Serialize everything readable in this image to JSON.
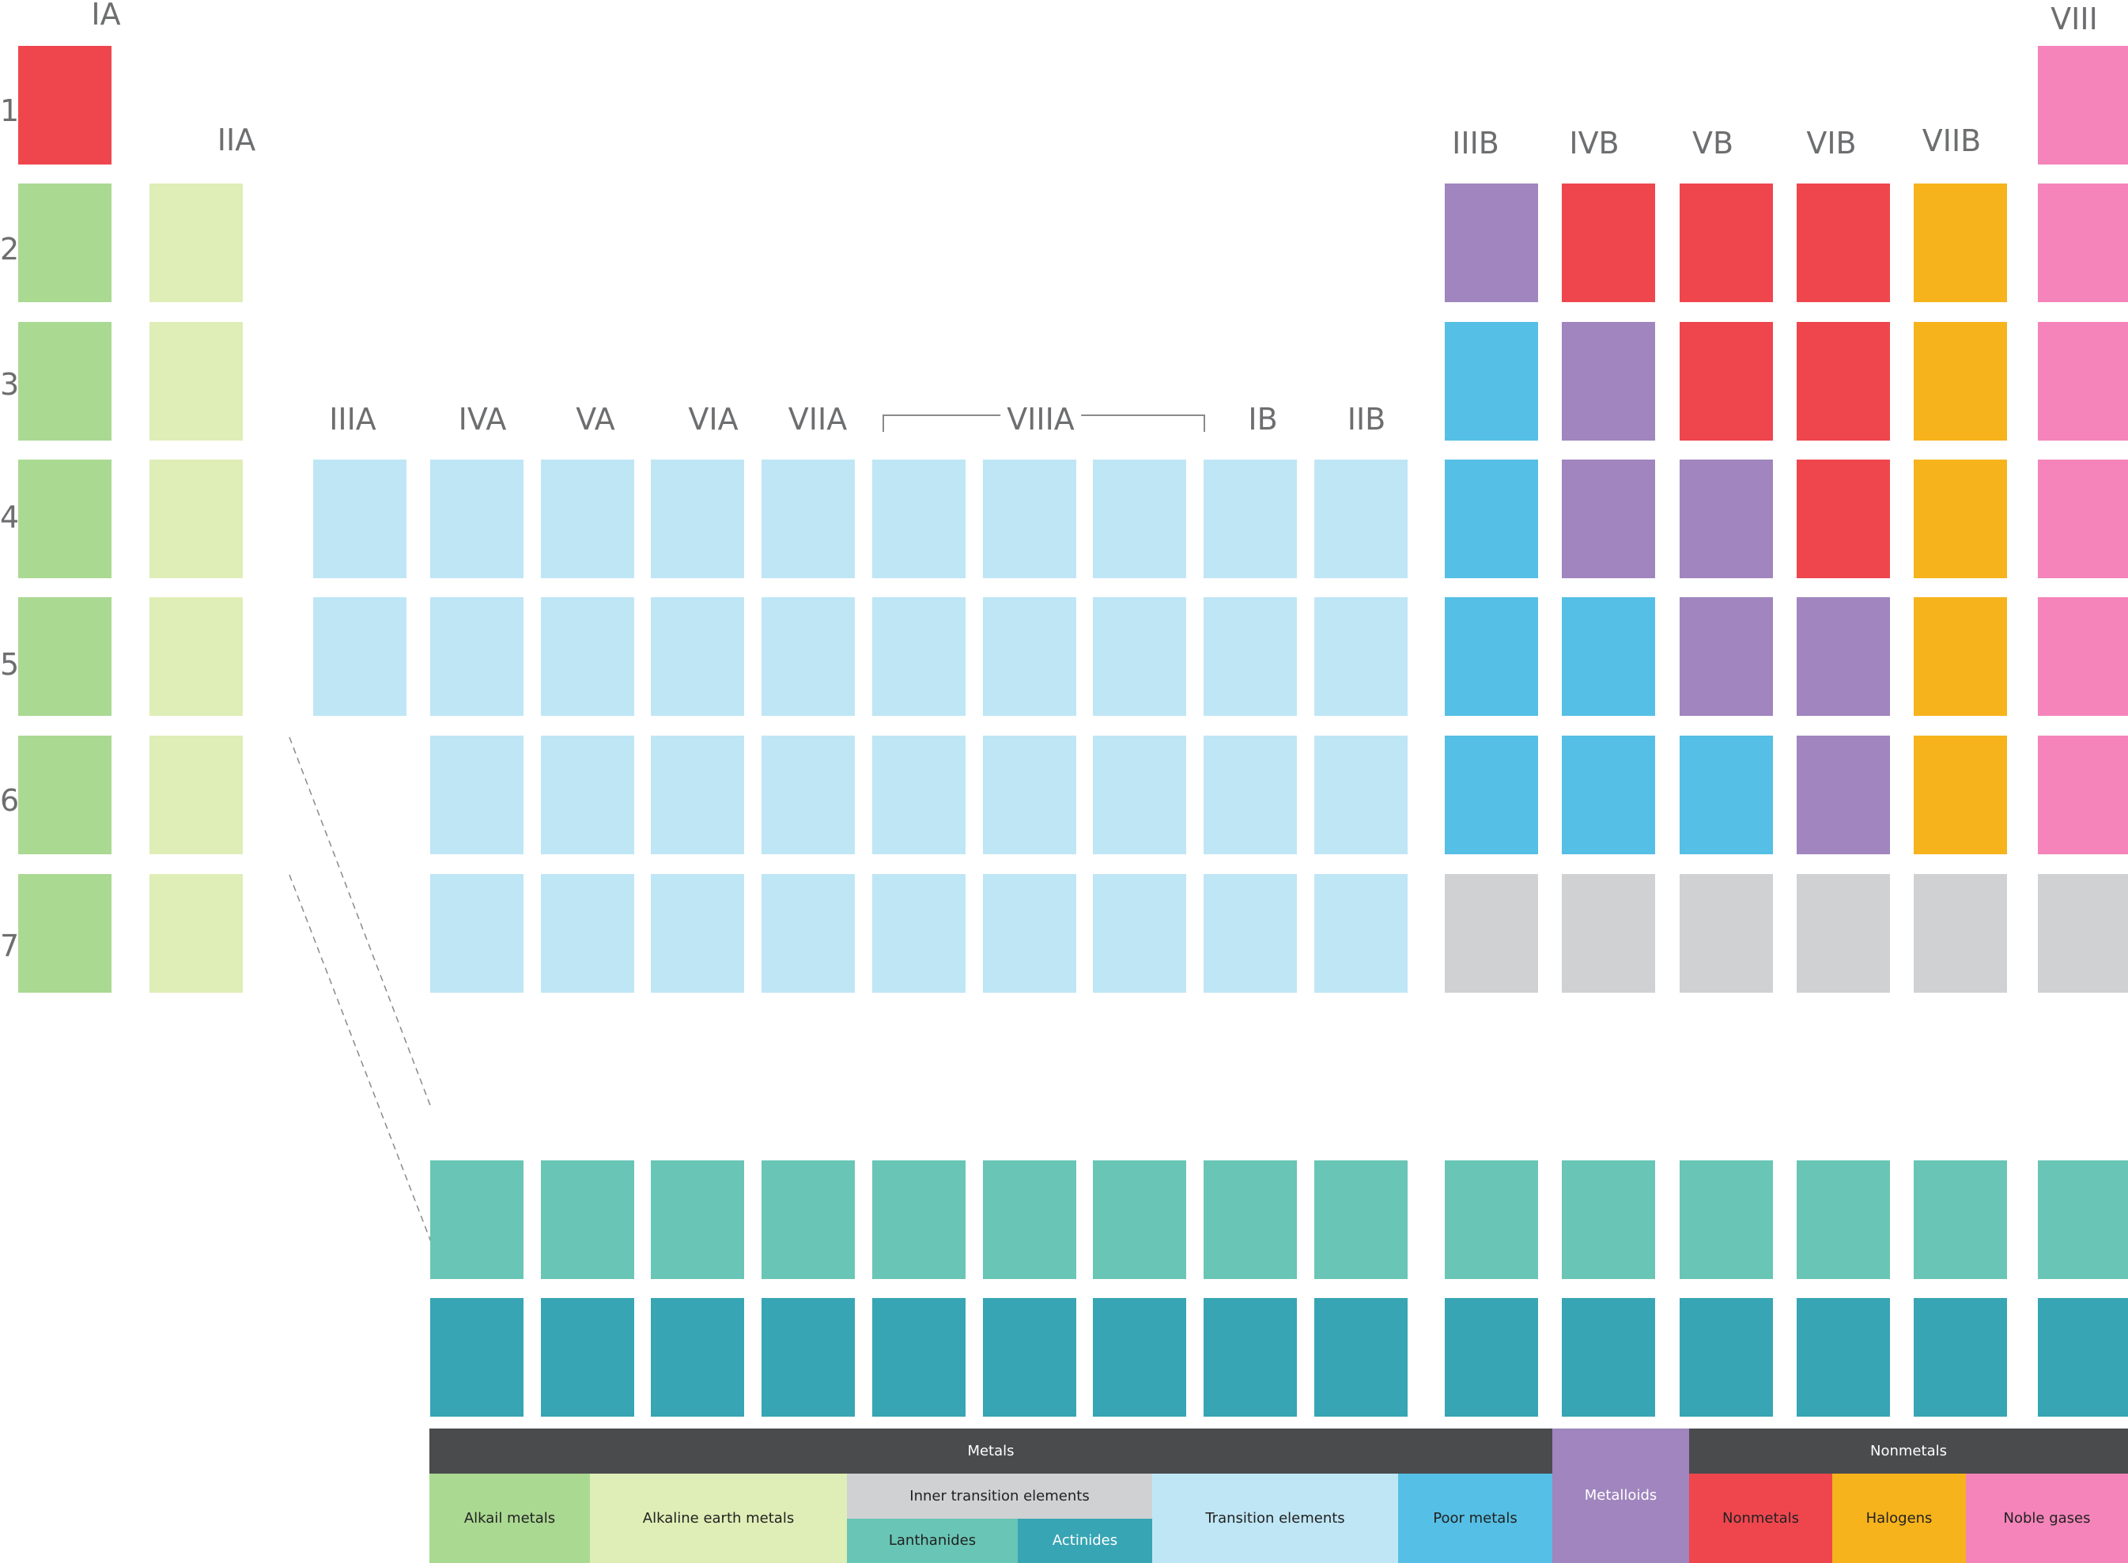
{
  "group_labels": [
    {
      "key": "IA",
      "text": "IA"
    },
    {
      "key": "IIA",
      "text": "IIA"
    },
    {
      "key": "IIIA",
      "text": "IIIA"
    },
    {
      "key": "IVA",
      "text": "IVA"
    },
    {
      "key": "VA",
      "text": "VA"
    },
    {
      "key": "VIA",
      "text": "VIA"
    },
    {
      "key": "VIIA",
      "text": "VIIA"
    },
    {
      "key": "VIIIA",
      "text": "VIIIA"
    },
    {
      "key": "IB",
      "text": "IB"
    },
    {
      "key": "IIB",
      "text": "IIB"
    },
    {
      "key": "IIIB",
      "text": "IIIB"
    },
    {
      "key": "IVB",
      "text": "IVB"
    },
    {
      "key": "VB",
      "text": "VB"
    },
    {
      "key": "VIB",
      "text": "VIB"
    },
    {
      "key": "VIIB",
      "text": "VIIB"
    },
    {
      "key": "VIII",
      "text": "VIII"
    }
  ],
  "period_labels": [
    "1",
    "2",
    "3",
    "4",
    "5",
    "6",
    "7"
  ],
  "colors": {
    "alkali": "#aad992",
    "alkaline": "#dfeeb6",
    "transition": "#bfe6f5",
    "poor": "#55bfe5",
    "metalloid": "#a085be",
    "nonmetal": "#ef464e",
    "halogen": "#f6b31c",
    "noble": "#f484b9",
    "inner": "#d0d1d3",
    "lanthanide": "#69c5b5",
    "actinide": "#37a5b4",
    "metals_bar": "#4a4b4d",
    "nonmetals_bar": "#4a4b4d",
    "connector": "#8a8a8a"
  },
  "cells": [
    {
      "col": 0,
      "row": 1,
      "cat": "nonmetal"
    },
    {
      "col": 17,
      "row": 1,
      "cat": "noble"
    },
    {
      "col": 0,
      "row": 2,
      "cat": "alkali"
    },
    {
      "col": 1,
      "row": 2,
      "cat": "alkaline"
    },
    {
      "col": 12,
      "row": 2,
      "cat": "metalloid"
    },
    {
      "col": 13,
      "row": 2,
      "cat": "nonmetal"
    },
    {
      "col": 14,
      "row": 2,
      "cat": "nonmetal"
    },
    {
      "col": 15,
      "row": 2,
      "cat": "nonmetal"
    },
    {
      "col": 16,
      "row": 2,
      "cat": "halogen"
    },
    {
      "col": 17,
      "row": 2,
      "cat": "noble"
    },
    {
      "col": 0,
      "row": 3,
      "cat": "alkali"
    },
    {
      "col": 1,
      "row": 3,
      "cat": "alkaline"
    },
    {
      "col": 12,
      "row": 3,
      "cat": "poor"
    },
    {
      "col": 13,
      "row": 3,
      "cat": "metalloid"
    },
    {
      "col": 14,
      "row": 3,
      "cat": "nonmetal"
    },
    {
      "col": 15,
      "row": 3,
      "cat": "nonmetal"
    },
    {
      "col": 16,
      "row": 3,
      "cat": "halogen"
    },
    {
      "col": 17,
      "row": 3,
      "cat": "noble"
    },
    {
      "col": 0,
      "row": 4,
      "cat": "alkali"
    },
    {
      "col": 1,
      "row": 4,
      "cat": "alkaline"
    },
    {
      "col": 2,
      "row": 4,
      "cat": "transition"
    },
    {
      "col": 3,
      "row": 4,
      "cat": "transition"
    },
    {
      "col": 4,
      "row": 4,
      "cat": "transition"
    },
    {
      "col": 5,
      "row": 4,
      "cat": "transition"
    },
    {
      "col": 6,
      "row": 4,
      "cat": "transition"
    },
    {
      "col": 7,
      "row": 4,
      "cat": "transition"
    },
    {
      "col": 8,
      "row": 4,
      "cat": "transition"
    },
    {
      "col": 9,
      "row": 4,
      "cat": "transition"
    },
    {
      "col": 10,
      "row": 4,
      "cat": "transition"
    },
    {
      "col": 11,
      "row": 4,
      "cat": "transition"
    },
    {
      "col": 12,
      "row": 4,
      "cat": "poor"
    },
    {
      "col": 13,
      "row": 4,
      "cat": "metalloid"
    },
    {
      "col": 14,
      "row": 4,
      "cat": "metalloid"
    },
    {
      "col": 15,
      "row": 4,
      "cat": "nonmetal"
    },
    {
      "col": 16,
      "row": 4,
      "cat": "halogen"
    },
    {
      "col": 17,
      "row": 4,
      "cat": "noble"
    },
    {
      "col": 0,
      "row": 5,
      "cat": "alkali"
    },
    {
      "col": 1,
      "row": 5,
      "cat": "alkaline"
    },
    {
      "col": 2,
      "row": 5,
      "cat": "transition"
    },
    {
      "col": 3,
      "row": 5,
      "cat": "transition"
    },
    {
      "col": 4,
      "row": 5,
      "cat": "transition"
    },
    {
      "col": 5,
      "row": 5,
      "cat": "transition"
    },
    {
      "col": 6,
      "row": 5,
      "cat": "transition"
    },
    {
      "col": 7,
      "row": 5,
      "cat": "transition"
    },
    {
      "col": 8,
      "row": 5,
      "cat": "transition"
    },
    {
      "col": 9,
      "row": 5,
      "cat": "transition"
    },
    {
      "col": 10,
      "row": 5,
      "cat": "transition"
    },
    {
      "col": 11,
      "row": 5,
      "cat": "transition"
    },
    {
      "col": 12,
      "row": 5,
      "cat": "poor"
    },
    {
      "col": 13,
      "row": 5,
      "cat": "poor"
    },
    {
      "col": 14,
      "row": 5,
      "cat": "metalloid"
    },
    {
      "col": 15,
      "row": 5,
      "cat": "metalloid"
    },
    {
      "col": 16,
      "row": 5,
      "cat": "halogen"
    },
    {
      "col": 17,
      "row": 5,
      "cat": "noble"
    },
    {
      "col": 0,
      "row": 6,
      "cat": "alkali"
    },
    {
      "col": 1,
      "row": 6,
      "cat": "alkaline"
    },
    {
      "col": 3,
      "row": 6,
      "cat": "transition"
    },
    {
      "col": 4,
      "row": 6,
      "cat": "transition"
    },
    {
      "col": 5,
      "row": 6,
      "cat": "transition"
    },
    {
      "col": 6,
      "row": 6,
      "cat": "transition"
    },
    {
      "col": 7,
      "row": 6,
      "cat": "transition"
    },
    {
      "col": 8,
      "row": 6,
      "cat": "transition"
    },
    {
      "col": 9,
      "row": 6,
      "cat": "transition"
    },
    {
      "col": 10,
      "row": 6,
      "cat": "transition"
    },
    {
      "col": 11,
      "row": 6,
      "cat": "transition"
    },
    {
      "col": 12,
      "row": 6,
      "cat": "poor"
    },
    {
      "col": 13,
      "row": 6,
      "cat": "poor"
    },
    {
      "col": 14,
      "row": 6,
      "cat": "poor"
    },
    {
      "col": 15,
      "row": 6,
      "cat": "metalloid"
    },
    {
      "col": 16,
      "row": 6,
      "cat": "halogen"
    },
    {
      "col": 17,
      "row": 6,
      "cat": "noble"
    },
    {
      "col": 0,
      "row": 7,
      "cat": "alkali"
    },
    {
      "col": 1,
      "row": 7,
      "cat": "alkaline"
    },
    {
      "col": 3,
      "row": 7,
      "cat": "transition"
    },
    {
      "col": 4,
      "row": 7,
      "cat": "transition"
    },
    {
      "col": 5,
      "row": 7,
      "cat": "transition"
    },
    {
      "col": 6,
      "row": 7,
      "cat": "transition"
    },
    {
      "col": 7,
      "row": 7,
      "cat": "transition"
    },
    {
      "col": 8,
      "row": 7,
      "cat": "transition"
    },
    {
      "col": 9,
      "row": 7,
      "cat": "transition"
    },
    {
      "col": 10,
      "row": 7,
      "cat": "transition"
    },
    {
      "col": 11,
      "row": 7,
      "cat": "transition"
    },
    {
      "col": 12,
      "row": 7,
      "cat": "inner"
    },
    {
      "col": 13,
      "row": 7,
      "cat": "inner"
    },
    {
      "col": 14,
      "row": 7,
      "cat": "inner"
    },
    {
      "col": 15,
      "row": 7,
      "cat": "inner"
    },
    {
      "col": 16,
      "row": 7,
      "cat": "inner"
    },
    {
      "col": 17,
      "row": 7,
      "cat": "inner"
    }
  ],
  "f_block": [
    {
      "row": "lanthanide",
      "cat": "lanthanide",
      "cols": [
        3,
        4,
        5,
        6,
        7,
        8,
        9,
        10,
        11,
        12,
        13,
        14,
        15,
        16,
        17
      ]
    },
    {
      "row": "actinide",
      "cat": "actinide",
      "cols": [
        3,
        4,
        5,
        6,
        7,
        8,
        9,
        10,
        11,
        12,
        13,
        14,
        15,
        16,
        17
      ]
    }
  ],
  "legend": {
    "metals_header": "Metals",
    "nonmetals_header": "Nonmetals",
    "alkali": "Alkail metals",
    "alkaline": "Alkaline earth metals",
    "inner": "Inner transition elements",
    "lanthanides": "Lanthanides",
    "actinides": "Actinides",
    "transition": "Transition elements",
    "poor": "Poor metals",
    "metalloids": "Metalloids",
    "nonmetals": "Nonmetals",
    "halogens": "Halogens",
    "noble": "Noble gases"
  }
}
